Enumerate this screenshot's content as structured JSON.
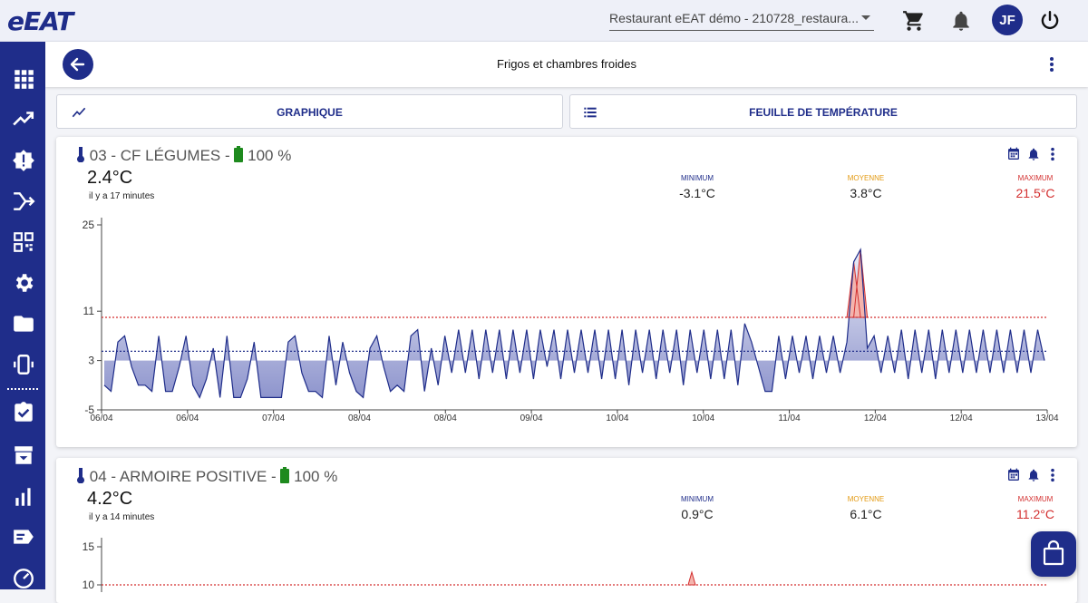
{
  "app": {
    "logo": "eEAT"
  },
  "topbar": {
    "restaurant_select": "Restaurant eEAT démo - 210728_restaura...",
    "user_initials": "JF"
  },
  "sidebar": {
    "items": [
      "dashboard-icon",
      "trending-up-icon",
      "alert-badge-icon",
      "workflow-icon",
      "qr-code-icon",
      "settings-icon",
      "folder-icon",
      "device-icon",
      "checklist-icon",
      "archive-icon",
      "bar-chart-icon",
      "labels-icon",
      "speedometer-icon"
    ]
  },
  "header": {
    "title": "Frigos et chambres froides"
  },
  "tabs": [
    {
      "label": "GRAPHIQUE",
      "icon": "line-chart-icon"
    },
    {
      "label": "FEUILLE DE TEMPÉRATURE",
      "icon": "list-icon"
    }
  ],
  "colors": {
    "primary": "#1f2d8a",
    "battery": "#1e8a1e",
    "min": "#1f2d8a",
    "avg": "#e39a12",
    "max": "#d32f2f"
  },
  "cards": [
    {
      "title": "03 - CF LÉGUMES - ",
      "battery": "100 %",
      "current_temp": "2.4°C",
      "updated": "il y a 17 minutes",
      "min_label": "MINIMUM",
      "min_value": "-3.1°C",
      "avg_label": "MOYENNE",
      "avg_value": "3.8°C",
      "max_label": "MAXIMUM",
      "max_value": "21.5°C"
    },
    {
      "title": "04 - ARMOIRE POSITIVE - ",
      "battery": "100 %",
      "current_temp": "4.2°C",
      "updated": "il y a 14 minutes",
      "min_label": "MINIMUM",
      "min_value": "0.9°C",
      "avg_label": "MOYENNE",
      "avg_value": "6.1°C",
      "max_label": "MAXIMUM",
      "max_value": "11.2°C"
    }
  ],
  "chart_data": [
    {
      "type": "area",
      "x_ticks": [
        "06/04",
        "06/04",
        "07/04",
        "08/04",
        "08/04",
        "09/04",
        "10/04",
        "10/04",
        "11/04",
        "12/04",
        "12/04",
        "13/04"
      ],
      "y_ticks": [
        25,
        11,
        3,
        -5
      ],
      "ylim": [
        -5,
        25
      ],
      "upper_threshold": 10,
      "lower_threshold": 3,
      "series": [
        {
          "values": [
            -1,
            -2,
            6,
            7,
            2,
            -1,
            -1,
            -2,
            7,
            -2,
            -2,
            2,
            7,
            -1,
            -3,
            0,
            5,
            -3,
            7,
            -3,
            -3,
            0,
            6,
            -3,
            -3,
            -3,
            -3,
            6,
            7,
            1,
            -2,
            -2,
            -3,
            7,
            -1,
            6,
            1,
            -2,
            -3,
            5,
            7,
            2,
            -2,
            -1,
            -2,
            7,
            8,
            -2,
            5,
            -1,
            7,
            1,
            8,
            1,
            8,
            0,
            8,
            1,
            8,
            0,
            8,
            1,
            8,
            0,
            8,
            2,
            8,
            0,
            8,
            1,
            8,
            1,
            8,
            0,
            8,
            0,
            8,
            -1,
            8,
            1,
            8,
            0,
            8,
            1,
            8,
            -1,
            8,
            1,
            8,
            0,
            8,
            0,
            8,
            -1,
            9,
            6,
            2,
            -2,
            -2,
            7,
            0,
            7,
            1,
            7,
            0,
            7,
            1,
            7,
            1,
            6,
            19,
            21,
            5,
            7,
            1,
            7,
            1,
            8,
            0,
            8,
            1,
            8,
            0,
            8,
            1,
            8,
            1,
            8,
            1,
            8,
            1,
            8,
            1,
            8,
            1,
            8,
            1,
            8,
            3
          ]
        }
      ]
    },
    {
      "type": "area",
      "y_ticks": [
        15,
        10
      ],
      "ylim": [
        0,
        15
      ],
      "upper_threshold": 10,
      "series": [
        {
          "values": []
        }
      ]
    }
  ]
}
